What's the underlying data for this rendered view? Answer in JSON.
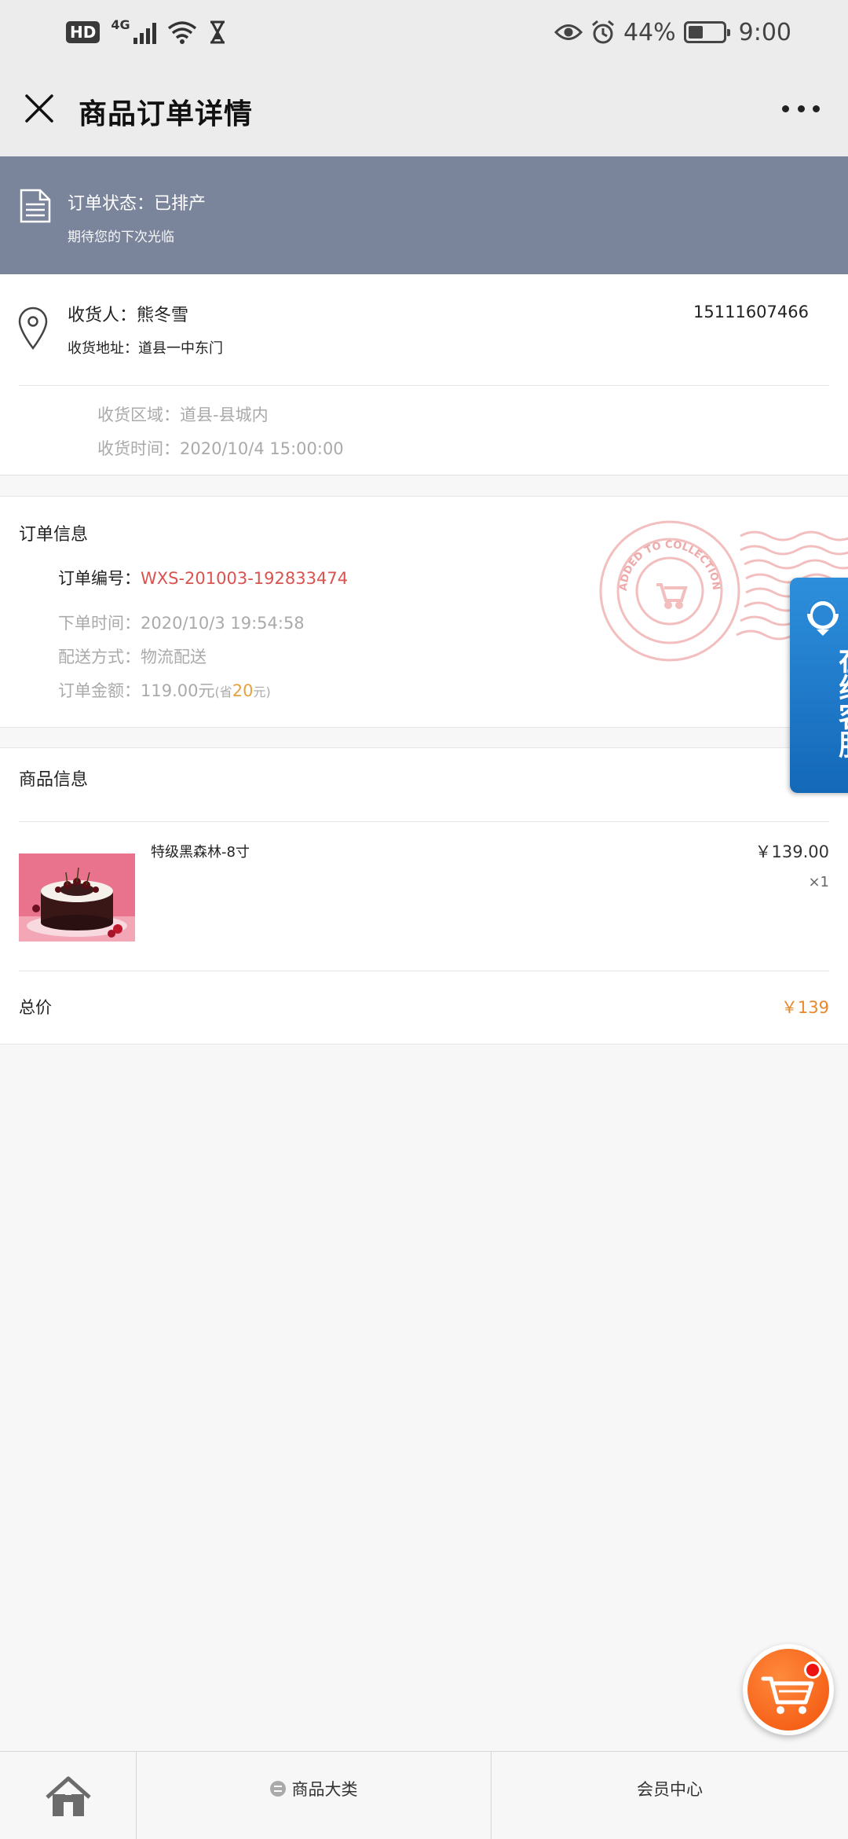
{
  "status_bar": {
    "hd": "HD",
    "network": "4G",
    "battery_text": "44%",
    "battery_level": 0.44,
    "time": "9:00",
    "icons": [
      "hd-badge",
      "signal-icon",
      "wifi-icon",
      "hourglass-icon",
      "eye-icon",
      "alarm-icon",
      "battery-icon"
    ]
  },
  "header": {
    "title": "商品订单详情",
    "close_icon": "close-icon",
    "more_icon": "more-dots-icon"
  },
  "order_status": {
    "title": "订单状态：已排产",
    "subtitle": "期待您的下次光临",
    "icon": "document-icon"
  },
  "receiver": {
    "name_row": "收货人：熊冬雪",
    "phone": "15111607466",
    "address_row": "收货地址：道县一中东门",
    "region_row": "收货区域：道县-县城内",
    "time_row": "收货时间：2020/10/4 15:00:00",
    "icon": "location-pin-icon"
  },
  "order_info": {
    "title": "订单信息",
    "order_no_label": "订单编号：",
    "order_no": "WXS-201003-192833474",
    "placed_row": "下单时间：2020/10/3 19:54:58",
    "delivery_row": "配送方式：物流配送",
    "amount_label": "订单金额：",
    "amount": "119.00元",
    "save_prefix": "(省",
    "save_value": "20",
    "save_suffix": "元)",
    "stamp_text": "ADDED TO COLLECTION"
  },
  "goods": {
    "title": "商品信息",
    "items": [
      {
        "name": "特级黑森林-8寸",
        "price": "￥139.00",
        "qty": "×1"
      }
    ],
    "total_label": "总价",
    "total_value": "￥139"
  },
  "service": {
    "label": "在线客服",
    "icon": "customer-service-icon"
  },
  "cart": {
    "icon": "shopping-cart-icon",
    "badge_color": "#ee1111"
  },
  "bottom_nav": {
    "home_icon": "home-icon",
    "category_label": "商品大类",
    "member_label": "会员中心"
  },
  "colors": {
    "banner": "#7a849b",
    "order_no": "#d9534f",
    "save_highlight": "#e6a23c",
    "total": "#e8882a",
    "service_tab": "#1f7ccb",
    "cart": "#f2520a"
  }
}
